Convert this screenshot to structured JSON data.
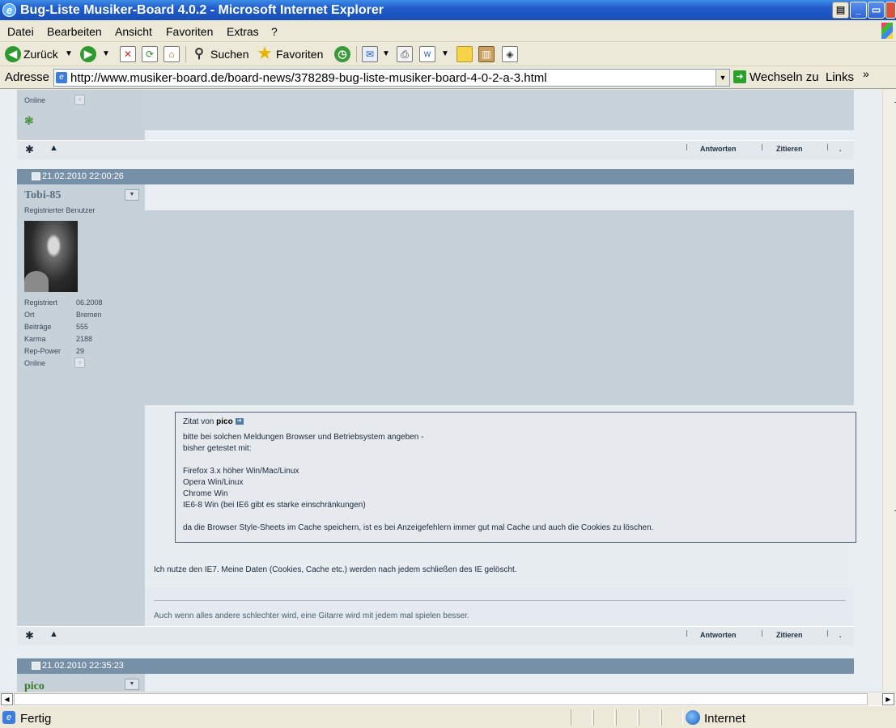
{
  "window": {
    "title": "Bug-Liste Musiker-Board 4.0.2 - Microsoft Internet Explorer",
    "controls": [
      "_",
      "▭",
      "✕"
    ]
  },
  "menu": [
    "Datei",
    "Bearbeiten",
    "Ansicht",
    "Favoriten",
    "Extras",
    "?"
  ],
  "toolbar": {
    "back": "Zurück",
    "search": "Suchen",
    "favorites": "Favoriten"
  },
  "address": {
    "label": "Adresse",
    "url": "http://www.musiker-board.de/board-news/378289-bug-liste-musiker-board-4-0-2-a-3.html",
    "go": "Wechseln zu",
    "links": "Links",
    "chevron": "»"
  },
  "prev_post": {
    "online_label": "Online",
    "reply": "Antworten",
    "quote": "Zitieren"
  },
  "post": {
    "date": "21.02.2010 22:00:26",
    "username": "Tobi-85",
    "role": "Registrierter Benutzer",
    "stats": [
      {
        "label": "Registriert",
        "value": "06.2008"
      },
      {
        "label": "Ort",
        "value": "Bremen"
      },
      {
        "label": "Beiträge",
        "value": "555"
      },
      {
        "label": "Karma",
        "value": "2188"
      },
      {
        "label": "Rep-Power",
        "value": "29"
      },
      {
        "label": "Online",
        "value": ""
      }
    ],
    "quote": {
      "prefix": "Zitat von",
      "author": "pico",
      "lines": [
        "bitte bei solchen Meldungen Browser und Betriebsystem angeben -",
        "bisher getestet mit:",
        "Firefox 3.x höher Win/Mac/Linux",
        "Opera Win/Linux",
        "Chrome Win",
        "IE6-8 Win (bei IE6 gibt es starke einschränkungen)",
        "da die Browser Style-Sheets im Cache speichern, ist es bei Anzeigefehlern immer gut mal Cache und auch die Cookies zu löschen."
      ]
    },
    "text": "Ich nutze den IE7. Meine Daten (Cookies, Cache etc.) werden nach jedem schließen des IE gelöscht.",
    "signature": "Auch wenn alles andere schlechter wird, eine Gitarre wird mit jedem mal spielen besser.",
    "reply": "Antworten",
    "quote_btn": "Zitieren"
  },
  "next_post": {
    "date": "21.02.2010 22:35:23",
    "username": "pico"
  },
  "status": {
    "text": "Fertig",
    "zone": "Internet"
  },
  "colors": {
    "header": "#7690a8",
    "sidebar": "#c6d1d9",
    "titlebar": "#1f5ccb"
  }
}
